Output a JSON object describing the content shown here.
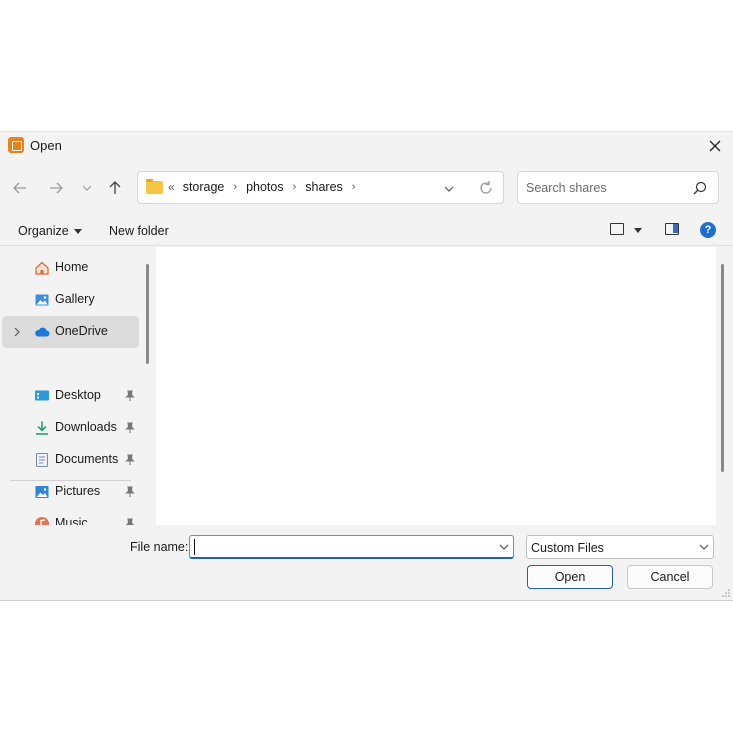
{
  "window": {
    "title": "Open",
    "app_icon": "document-app-icon",
    "close_icon": "close-icon"
  },
  "nav": {
    "back_icon": "arrow-left-icon",
    "forward_icon": "arrow-right-icon",
    "recent_icon": "chevron-down-icon",
    "up_icon": "arrow-up-icon"
  },
  "address": {
    "overflow": "«",
    "breadcrumbs": [
      "storage",
      "photos",
      "shares"
    ],
    "separator": "›"
  },
  "search": {
    "placeholder": "Search shares"
  },
  "toolbar": {
    "organize_label": "Organize",
    "new_folder_label": "New folder",
    "help_label": "?"
  },
  "sidebar": {
    "items": [
      {
        "label": "Home",
        "icon": "home-icon"
      },
      {
        "label": "Gallery",
        "icon": "gallery-icon"
      },
      {
        "label": "OneDrive",
        "icon": "cloud-icon",
        "selected": true
      },
      {
        "label": "Desktop",
        "icon": "desktop-icon",
        "pinned": true
      },
      {
        "label": "Downloads",
        "icon": "download-icon",
        "pinned": true
      },
      {
        "label": "Documents",
        "icon": "documents-icon",
        "pinned": true
      },
      {
        "label": "Pictures",
        "icon": "pictures-icon",
        "pinned": true
      },
      {
        "label": "Music",
        "icon": "music-icon",
        "pinned": true
      }
    ]
  },
  "footer": {
    "file_name_label": "File name:",
    "file_name_value": "",
    "file_type_selected": "Custom Files",
    "open_label": "Open",
    "cancel_label": "Cancel"
  },
  "colors": {
    "accent": "#1f5fb4",
    "dialog_bg": "#f3f3f3",
    "selected_bg": "#dcdcdc",
    "folder": "#f6c542"
  }
}
